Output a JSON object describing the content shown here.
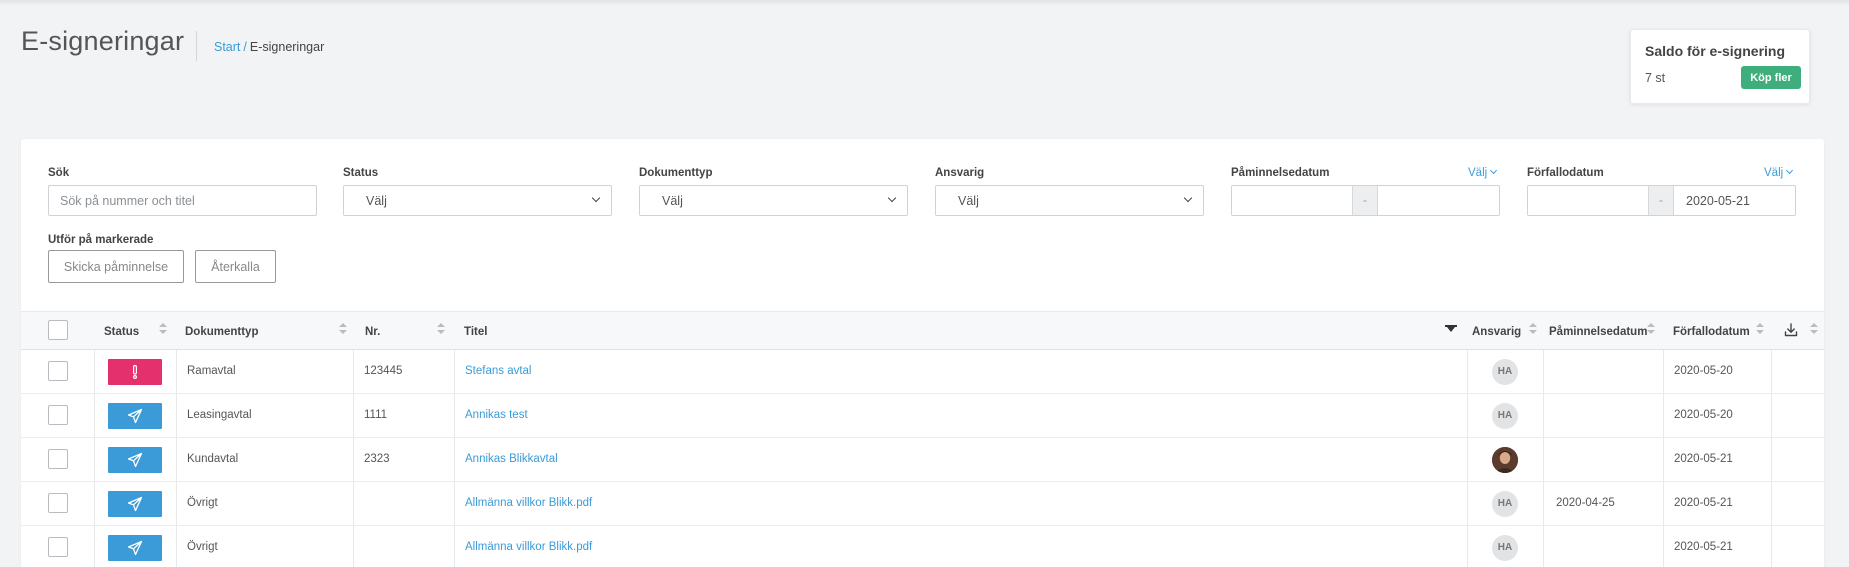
{
  "header": {
    "title": "E-signeringar",
    "breadcrumb": {
      "home": "Start",
      "separator": "/",
      "current": "E-signeringar"
    }
  },
  "saldo": {
    "title": "Saldo för e-signering",
    "value": "7 st",
    "buy_label": "Köp fler"
  },
  "filters": {
    "search": {
      "label": "Sök",
      "placeholder": "Sök på nummer och titel",
      "value": ""
    },
    "status": {
      "label": "Status",
      "value": "Välj"
    },
    "document_type": {
      "label": "Dokumenttyp",
      "value": "Välj"
    },
    "responsible": {
      "label": "Ansvarig",
      "value": "Välj"
    },
    "reminder_date": {
      "label": "Påminnelsedatum",
      "choose_label": "Välj",
      "dash": "-",
      "from": "",
      "to": ""
    },
    "due_date": {
      "label": "Förfallodatum",
      "choose_label": "Välj",
      "dash": "-",
      "from": "",
      "to": "2020-05-21"
    }
  },
  "bulk": {
    "label": "Utför på markerade",
    "send_reminder_label": "Skicka påminnelse",
    "revoke_label": "Återkalla"
  },
  "table": {
    "columns": {
      "status": "Status",
      "document_type": "Dokumenttyp",
      "number": "Nr.",
      "title": "Titel",
      "responsible": "Ansvarig",
      "reminder_date": "Påminnelsedatum",
      "due_date": "Förfallodatum"
    },
    "rows": [
      {
        "status": "warning",
        "status_icon": "exclamation-icon",
        "document_type": "Ramavtal",
        "number": "123445",
        "title": "Stefans avtal",
        "responsible": "HA",
        "responsible_type": "initials",
        "reminder_date": "",
        "due_date": "2020-05-20"
      },
      {
        "status": "sent",
        "status_icon": "paper-plane-icon",
        "document_type": "Leasingavtal",
        "number": "1111",
        "title": "Annikas test",
        "responsible": "HA",
        "responsible_type": "initials",
        "reminder_date": "",
        "due_date": "2020-05-20"
      },
      {
        "status": "sent",
        "status_icon": "paper-plane-icon",
        "document_type": "Kundavtal",
        "number": "2323",
        "title": "Annikas Blikkavtal",
        "responsible": "",
        "responsible_type": "photo",
        "reminder_date": "",
        "due_date": "2020-05-21"
      },
      {
        "status": "sent",
        "status_icon": "paper-plane-icon",
        "document_type": "Övrigt",
        "number": "",
        "title": "Allmänna villkor Blikk.pdf",
        "responsible": "HA",
        "responsible_type": "initials",
        "reminder_date": "2020-04-25",
        "due_date": "2020-05-21"
      },
      {
        "status": "sent",
        "status_icon": "paper-plane-icon",
        "document_type": "Övrigt",
        "number": "",
        "title": "Allmänna villkor Blikk.pdf",
        "responsible": "HA",
        "responsible_type": "initials",
        "reminder_date": "",
        "due_date": "2020-05-21"
      }
    ]
  },
  "colors": {
    "accent": "#3a9bd8",
    "warning": "#e5306e",
    "success": "#3eaf7c"
  }
}
